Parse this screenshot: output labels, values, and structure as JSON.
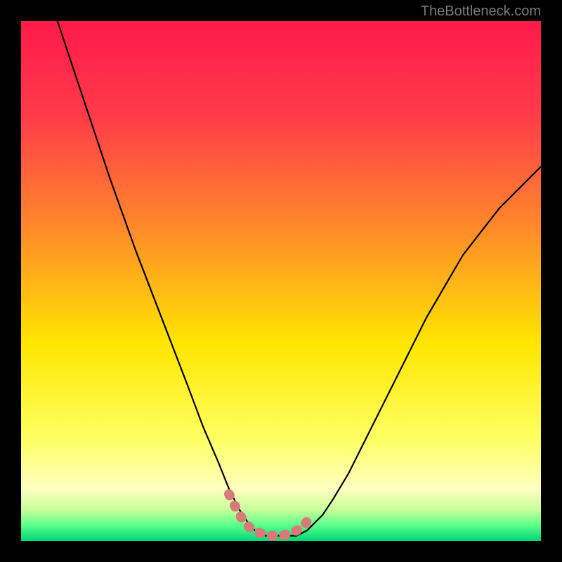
{
  "attribution": "TheBottleneck.com",
  "colors": {
    "frame": "#000000",
    "gradient_top": "#ff1a4a",
    "gradient_mid_upper": "#ff7a2a",
    "gradient_mid": "#ffe600",
    "gradient_lower": "#ffff9a",
    "gradient_base": "#00e676",
    "curve": "#000000",
    "marker": "#d87a7a"
  },
  "chart_data": {
    "type": "line",
    "title": "",
    "xlabel": "",
    "ylabel": "",
    "xlim": [
      0,
      100
    ],
    "ylim": [
      0,
      100
    ],
    "series": [
      {
        "name": "curve",
        "x": [
          7,
          12,
          17,
          22,
          27,
          32,
          35,
          38,
          40,
          42,
          44,
          45,
          47,
          50,
          53,
          55,
          56,
          58,
          60,
          63,
          67,
          72,
          78,
          85,
          92,
          100
        ],
        "y": [
          100,
          85,
          70,
          56,
          43,
          30,
          22,
          15,
          10,
          6,
          3,
          2,
          1,
          1,
          1,
          2,
          3,
          5,
          8,
          13,
          21,
          31,
          43,
          55,
          64,
          72
        ]
      }
    ],
    "markers": {
      "name": "highlight-segment",
      "x": [
        40,
        42,
        44,
        46,
        48,
        50,
        52,
        54,
        56
      ],
      "y": [
        9,
        5,
        2.5,
        1.5,
        1,
        1,
        1.5,
        2.5,
        5
      ]
    }
  }
}
